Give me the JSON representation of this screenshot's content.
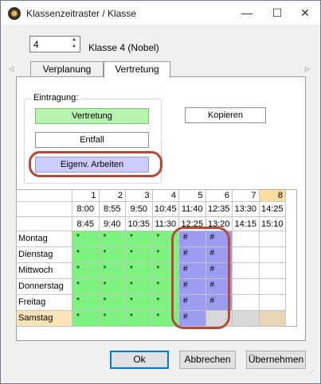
{
  "window": {
    "title": "Klassenzeitraster / Klasse",
    "minimize": "—",
    "maximize": "☐",
    "close": "✕"
  },
  "spin": {
    "value": "4",
    "up": "▲",
    "down": "▼"
  },
  "class_label": "Klasse 4 (Nobel)",
  "tabs": {
    "scroll_left": "◁",
    "scroll_right": "▷",
    "items": [
      "Verplanung",
      "Vertretung"
    ],
    "active": "Vertretung"
  },
  "eintragung": {
    "label": "Eintragung:",
    "vertretung": "Vertretung",
    "entfall": "Entfall",
    "eigenv": "Eigenv. Arbeiten",
    "kopieren": "Kopieren"
  },
  "colors": {
    "green": "#7ef27e",
    "lila": "#9b9bf0",
    "gray": "#d8d8d8",
    "orange_head": "#ffdca0",
    "samstag_label": "#fde3b8",
    "beige": "#e8d4b6",
    "highlight_oval": "#b54a3a"
  },
  "grid": {
    "periods": [
      "1",
      "2",
      "3",
      "4",
      "5",
      "6",
      "7",
      "8"
    ],
    "starts": [
      "8:00",
      "8:55",
      "9:50",
      "10:45",
      "11:40",
      "12:35",
      "13:30",
      "14:25"
    ],
    "ends": [
      "8:45",
      "9:40",
      "10:35",
      "11:30",
      "12:25",
      "13:20",
      "14:15",
      "15:10"
    ],
    "days": [
      {
        "name": "Montag",
        "cells": [
          "*",
          "*",
          "*",
          "*",
          "#",
          "#",
          "",
          ""
        ],
        "fills": [
          "green",
          "green",
          "green",
          "green",
          "lila",
          "lila",
          "white",
          "white"
        ]
      },
      {
        "name": "Dienstag",
        "cells": [
          "*",
          "*",
          "*",
          "*",
          "#",
          "#",
          "",
          ""
        ],
        "fills": [
          "green",
          "green",
          "green",
          "green",
          "lila",
          "lila",
          "white",
          "white"
        ]
      },
      {
        "name": "Mittwoch",
        "cells": [
          "*",
          "*",
          "*",
          "*",
          "#",
          "#",
          "",
          ""
        ],
        "fills": [
          "green",
          "green",
          "green",
          "green",
          "lila",
          "lila",
          "white",
          "white"
        ]
      },
      {
        "name": "Donnerstag",
        "cells": [
          "*",
          "*",
          "*",
          "*",
          "#",
          "#",
          "",
          ""
        ],
        "fills": [
          "green",
          "green",
          "green",
          "green",
          "lila",
          "lila",
          "white",
          "white"
        ]
      },
      {
        "name": "Freitag",
        "cells": [
          "*",
          "*",
          "*",
          "*",
          "#",
          "#",
          "",
          ""
        ],
        "fills": [
          "green",
          "green",
          "green",
          "green",
          "lila",
          "lila",
          "white",
          "white"
        ]
      },
      {
        "name": "Samstag",
        "cells": [
          "*",
          "*",
          "*",
          "*",
          "#",
          "",
          "",
          ""
        ],
        "fills": [
          "green",
          "green",
          "green",
          "green",
          "lila",
          "gray",
          "gray",
          "beige"
        ]
      }
    ]
  },
  "buttons": {
    "ok": "Ok",
    "cancel": "Abbrechen",
    "apply": "Übernehmen"
  }
}
